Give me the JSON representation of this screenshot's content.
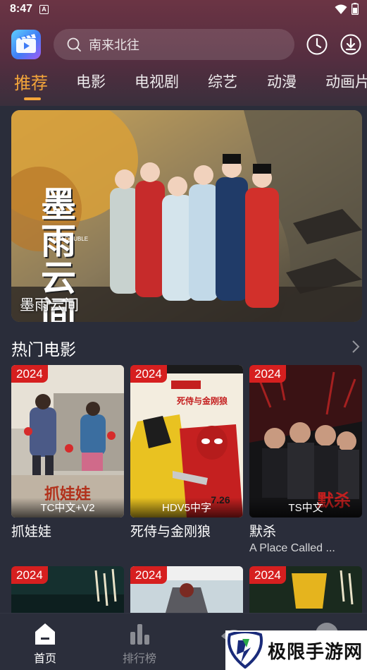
{
  "status_bar": {
    "time": "8:47",
    "notification_icon": "A"
  },
  "header": {
    "logo_icon": "video-play-logo",
    "search_placeholder": "南来北往",
    "history_icon": "clock-icon",
    "download_icon": "download-icon"
  },
  "tabs": [
    {
      "label": "推荐",
      "active": true
    },
    {
      "label": "电影",
      "active": false
    },
    {
      "label": "电视剧",
      "active": false
    },
    {
      "label": "综艺",
      "active": false
    },
    {
      "label": "动漫",
      "active": false
    },
    {
      "label": "动画片",
      "active": false
    }
  ],
  "banner": {
    "title": "墨雨云间",
    "poster_title": "墨雨云间",
    "poster_subtitle": "THE DOUBLE"
  },
  "hot_movies": {
    "title": "热门电影",
    "items": [
      {
        "year": "2024",
        "quality": "TC中文+V2",
        "title": "抓娃娃",
        "subtitle": "",
        "poster_text": "抓娃娃"
      },
      {
        "year": "2024",
        "quality": "HDV5中字",
        "title": "死侍与金刚狼",
        "subtitle": "",
        "poster_text": "死侍与金刚狼",
        "poster_date": "7.26"
      },
      {
        "year": "2024",
        "quality": "TS中文",
        "title": "默杀",
        "subtitle": "A Place Called ...",
        "poster_text": "默杀"
      }
    ],
    "row2": [
      {
        "year": "2024"
      },
      {
        "year": "2024"
      },
      {
        "year": "2024"
      }
    ]
  },
  "bottom_nav": [
    {
      "label": "首页",
      "icon": "home-icon",
      "active": true
    },
    {
      "label": "排行榜",
      "icon": "bar-chart-icon",
      "active": false
    },
    {
      "label": "",
      "icon": "eye-icon",
      "active": false
    },
    {
      "label": "",
      "icon": "profile-icon",
      "active": false
    }
  ],
  "watermark": {
    "text": "极限手游网"
  },
  "colors": {
    "accent": "#f4a53a",
    "badge": "#d61f1f",
    "background": "#2a2d3a"
  }
}
